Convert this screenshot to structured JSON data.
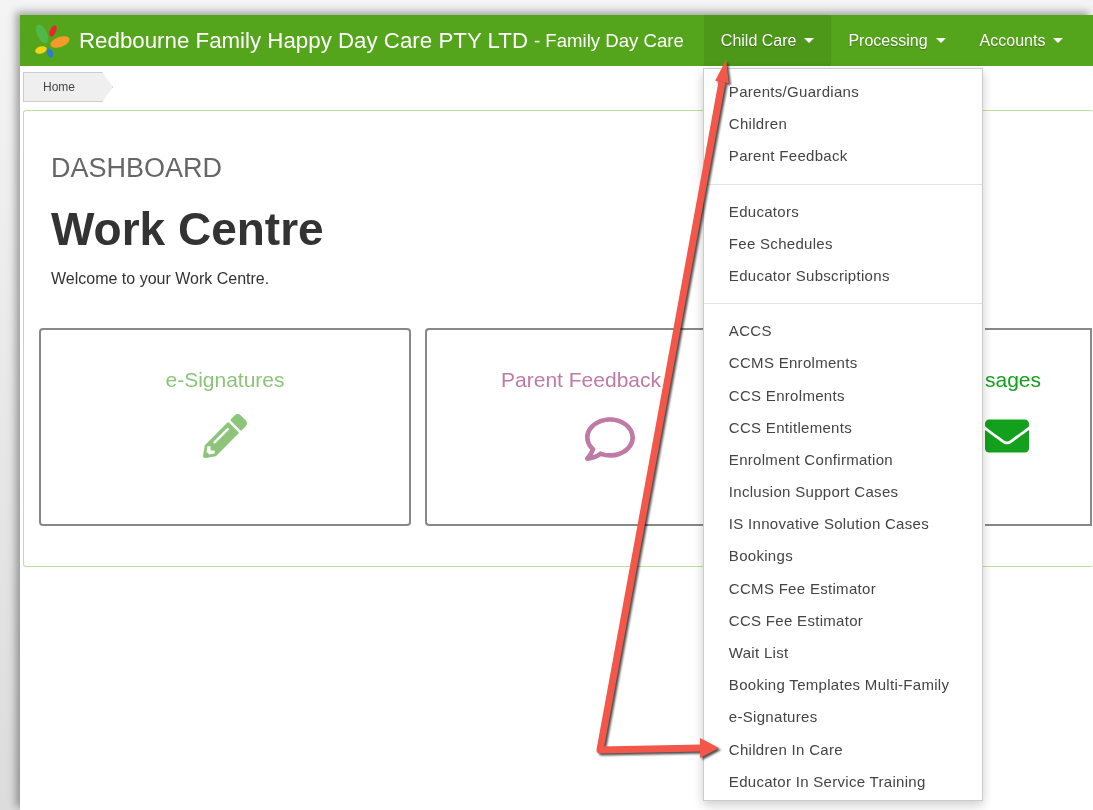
{
  "navbar": {
    "brand": "Redbourne Family Happy Day Care PTY LTD",
    "subtitle": "- Family Day Care",
    "menus": [
      {
        "label": "Child Care",
        "open": true
      },
      {
        "label": "Processing",
        "open": false
      },
      {
        "label": "Accounts",
        "open": false
      }
    ]
  },
  "breadcrumb": [
    "Home"
  ],
  "page": {
    "section": "DASHBOARD",
    "title": "Work Centre",
    "welcome": "Welcome to your Work Centre."
  },
  "cards": [
    {
      "title": "e-Signatures",
      "kind": "pencil",
      "color": "#8cc57a"
    },
    {
      "title": "Parent Feedback",
      "kind": "comment",
      "color": "#c07aa6"
    },
    {
      "title": "sages",
      "kind": "envelope",
      "color": "#13a01c"
    }
  ],
  "dropdown": {
    "groups": [
      [
        "Parents/Guardians",
        "Children",
        "Parent Feedback"
      ],
      [
        "Educators",
        "Fee Schedules",
        "Educator Subscriptions"
      ],
      [
        "ACCS",
        "CCMS Enrolments",
        "CCS Enrolments",
        "CCS Entitlements",
        "Enrolment Confirmation",
        "Inclusion Support Cases",
        "IS Innovative Solution Cases",
        "Bookings",
        "CCMS Fee Estimator",
        "CCS Fee Estimator",
        "Wait List",
        "Booking Templates Multi-Family",
        "e-Signatures",
        "Children In Care",
        "Educator In Service Training"
      ]
    ]
  }
}
